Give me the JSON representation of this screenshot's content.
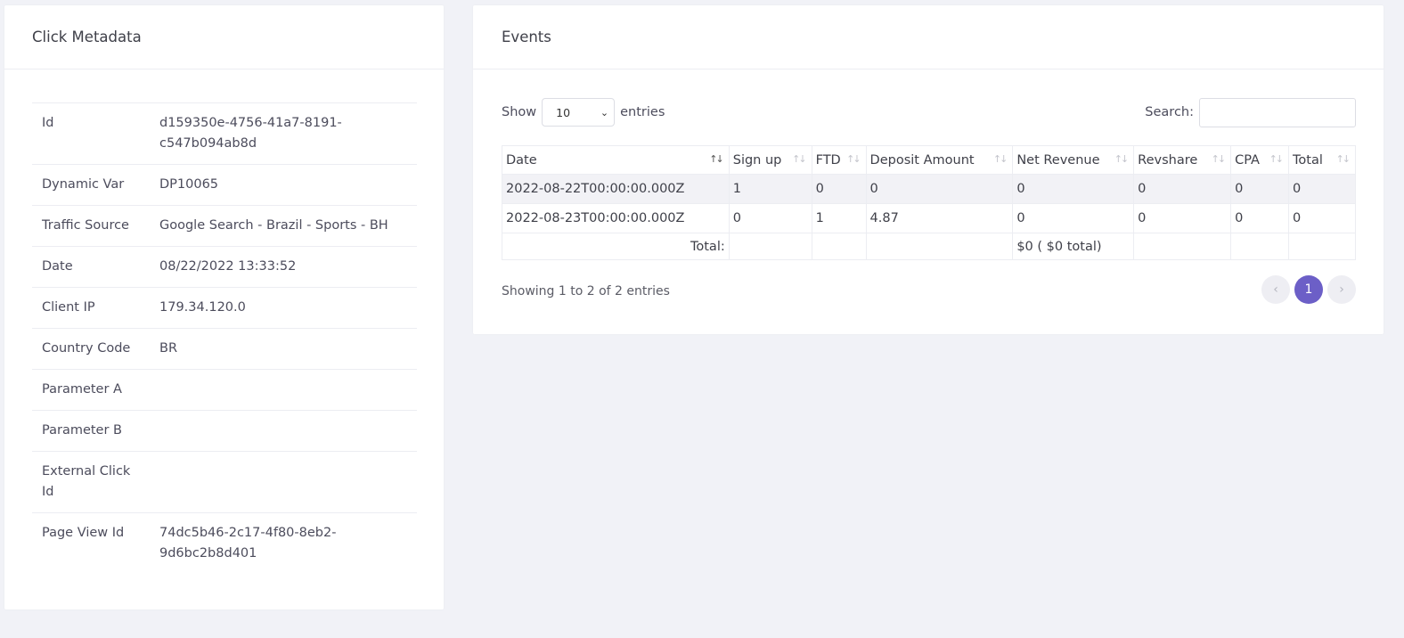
{
  "meta": {
    "title": "Click Metadata",
    "rows": [
      {
        "label": "Id",
        "value": "d159350e-4756-41a7-8191-c547b094ab8d"
      },
      {
        "label": "Dynamic Var",
        "value": "DP10065"
      },
      {
        "label": "Traffic Source",
        "value": "Google Search - Brazil - Sports - BH"
      },
      {
        "label": "Date",
        "value": "08/22/2022 13:33:52"
      },
      {
        "label": "Client IP",
        "value": "179.34.120.0"
      },
      {
        "label": "Country Code",
        "value": "BR"
      },
      {
        "label": "Parameter A",
        "value": ""
      },
      {
        "label": "Parameter B",
        "value": ""
      },
      {
        "label": "External Click Id",
        "value": ""
      },
      {
        "label": "Page View Id",
        "value": "74dc5b46-2c17-4f80-8eb2-9d6bc2b8d401"
      }
    ]
  },
  "events": {
    "title": "Events",
    "show_label": "Show",
    "entries_label": "entries",
    "page_length": "10",
    "search_label": "Search:",
    "search_value": "",
    "columns": [
      "Date",
      "Sign up",
      "FTD",
      "Deposit Amount",
      "Net Revenue",
      "Revshare",
      "CPA",
      "Total"
    ],
    "rows": [
      [
        "2022-08-22T00:00:00.000Z",
        "1",
        "0",
        "0",
        "0",
        "0",
        "0",
        "0"
      ],
      [
        "2022-08-23T00:00:00.000Z",
        "0",
        "1",
        "4.87",
        "0",
        "0",
        "0",
        "0"
      ]
    ],
    "footer": {
      "label": "Total:",
      "net_revenue": "$0 ( $0 total)"
    },
    "info": "Showing 1 to 2 of 2 entries",
    "pagination": {
      "prev": "‹",
      "current": "1",
      "next": "›"
    }
  }
}
